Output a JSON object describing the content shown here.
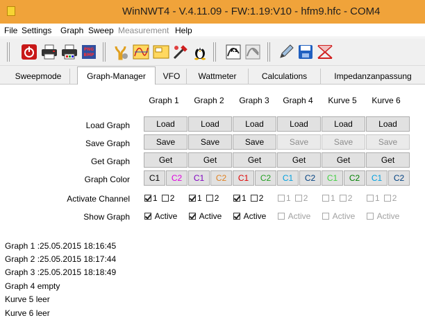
{
  "window": {
    "title": "WinNWT4 - V.4.11.09 - FW:1.19:V10 - hfm9.hfc - COM4"
  },
  "menu": [
    {
      "label": "File",
      "enabled": true
    },
    {
      "label": "Settings",
      "enabled": true
    },
    {
      "label": "Graph",
      "enabled": true
    },
    {
      "label": "Sweep",
      "enabled": true
    },
    {
      "label": "Measurement",
      "enabled": false
    },
    {
      "label": "Help",
      "enabled": true
    }
  ],
  "toolbar": {
    "icons": [
      "power-icon",
      "printer-icon",
      "printer-pdf-icon",
      "config-icon",
      "settings-icon",
      "graph-icon",
      "memo-icon",
      "probe-icon",
      "linux-icon",
      "k1-icon",
      "calibrate-icon",
      "pen-icon",
      "save-icon",
      "marker-icon"
    ],
    "icon_labels": {
      "printer_pdf": "PNG BMP"
    }
  },
  "tabs": [
    "Sweepmode",
    "Graph-Manager",
    "VFO",
    "Wattmeter",
    "Calculations",
    "Impedanzanpassung"
  ],
  "active_tab": "Graph-Manager",
  "columns": [
    "Graph 1",
    "Graph 2",
    "Graph 3",
    "Graph 4",
    "Kurve 5",
    "Kurve 6"
  ],
  "rows": {
    "load": {
      "label": "Load Graph",
      "button": "Load",
      "enabled": [
        true,
        true,
        true,
        true,
        true,
        true
      ]
    },
    "save": {
      "label": "Save Graph",
      "button": "Save",
      "enabled": [
        true,
        true,
        true,
        false,
        false,
        false
      ]
    },
    "get": {
      "label": "Get Graph",
      "button": "Get",
      "enabled": [
        true,
        true,
        true,
        true,
        true,
        true
      ]
    },
    "color": {
      "label": "Graph Color",
      "pairs": [
        [
          {
            "text": "C1",
            "color": "#000000"
          },
          {
            "text": "C2",
            "color": "#e000e0"
          }
        ],
        [
          {
            "text": "C1",
            "color": "#8000c0"
          },
          {
            "text": "C2",
            "color": "#e08020"
          }
        ],
        [
          {
            "text": "C1",
            "color": "#e00000"
          },
          {
            "text": "C2",
            "color": "#20a020"
          }
        ],
        [
          {
            "text": "C1",
            "color": "#00a0e0"
          },
          {
            "text": "C2",
            "color": "#004080"
          }
        ],
        [
          {
            "text": "C1",
            "color": "#40d040"
          },
          {
            "text": "C2",
            "color": "#008000"
          }
        ],
        [
          {
            "text": "C1",
            "color": "#00a0e0"
          },
          {
            "text": "C2",
            "color": "#004080"
          }
        ]
      ]
    },
    "channel": {
      "label": "Activate Channel",
      "ch1": "1",
      "ch2": "2",
      "states": [
        {
          "c1": true,
          "c2": false,
          "enabled": true
        },
        {
          "c1": true,
          "c2": false,
          "enabled": true
        },
        {
          "c1": true,
          "c2": false,
          "enabled": true
        },
        {
          "c1": false,
          "c2": false,
          "enabled": false
        },
        {
          "c1": false,
          "c2": false,
          "enabled": false
        },
        {
          "c1": false,
          "c2": false,
          "enabled": false
        }
      ]
    },
    "show": {
      "label": "Show Graph",
      "text": "Active",
      "states": [
        {
          "checked": true,
          "enabled": true
        },
        {
          "checked": true,
          "enabled": true
        },
        {
          "checked": true,
          "enabled": true
        },
        {
          "checked": false,
          "enabled": false
        },
        {
          "checked": false,
          "enabled": false
        },
        {
          "checked": false,
          "enabled": false
        }
      ]
    }
  },
  "info_lines": [
    "Graph 1 :25.05.2015 18:16:45",
    "Graph 2 :25.05.2015 18:17:44",
    "Graph 3 :25.05.2015 18:18:49",
    "Graph 4 empty",
    "Kurve 5 leer",
    "Kurve 6 leer"
  ]
}
